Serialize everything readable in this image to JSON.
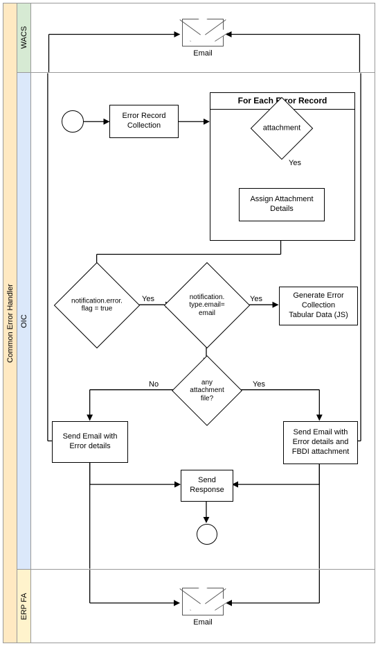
{
  "title": "Common Error Handler",
  "lanes": {
    "wacs": {
      "label": "WACS",
      "email_caption": "Email"
    },
    "oic": {
      "label": "OIC",
      "nodes": {
        "error_record_collection": "Error Record\nCollection",
        "for_each_title": "For Each Error Record",
        "attachment_decision": "attachment",
        "attachment_yes": "Yes",
        "assign_attachment": "Assign Attachment\nDetails",
        "flag_decision": "notification.error.\nflag = true",
        "flag_yes": "Yes",
        "type_decision": "notification.\ntype.email=\nemail",
        "type_yes": "Yes",
        "generate_tabular": "Generate Error\nCollection\nTabular Data (JS)",
        "any_attach_decision": "any\nattachment\nfile?",
        "any_attach_yes": "Yes",
        "any_attach_no": "No",
        "send_email_plain": "Send Email with\nError details",
        "send_email_fbdi": "Send Email with\nError details and\nFBDI attachment",
        "send_response": "Send\nResponse"
      }
    },
    "erp": {
      "label": "ERP FA",
      "email_caption": "Email"
    }
  }
}
